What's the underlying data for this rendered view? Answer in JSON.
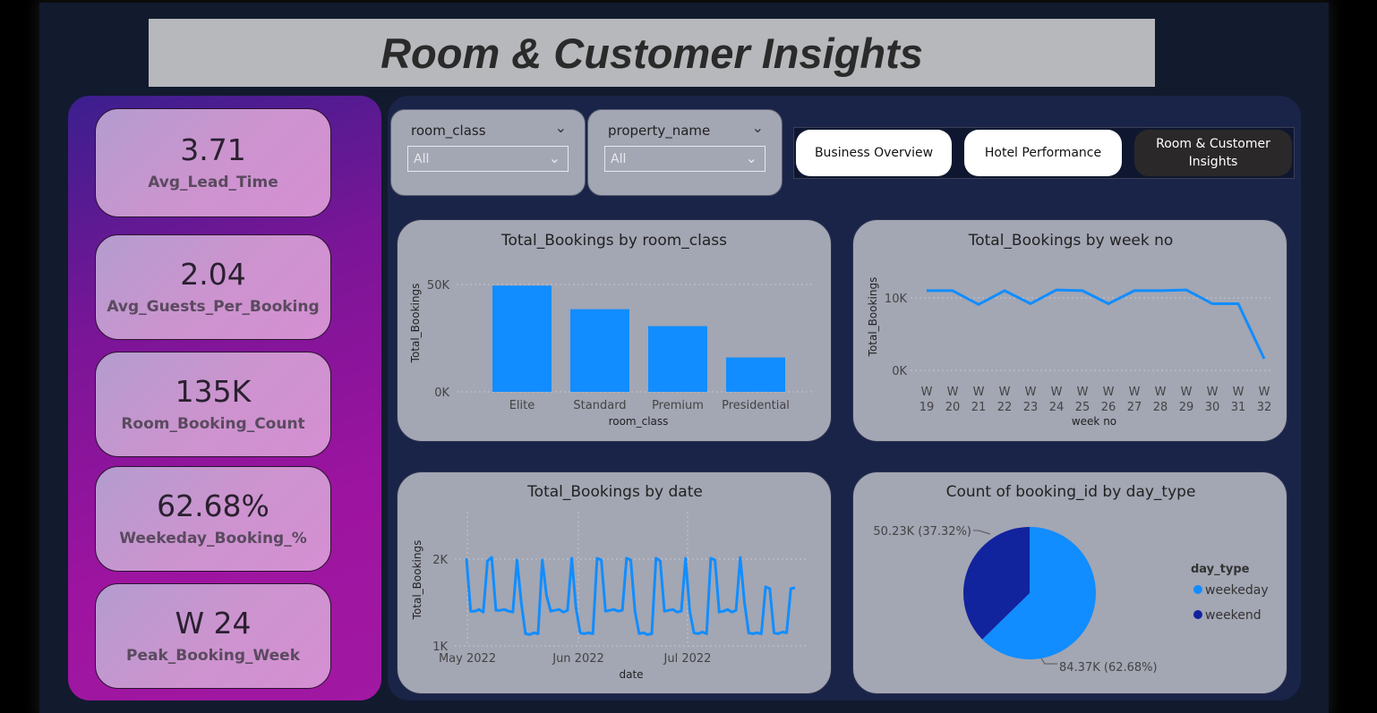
{
  "header": {
    "title": "Room & Customer Insights"
  },
  "kpis": [
    {
      "value": "3.71",
      "label": "Avg_Lead_Time"
    },
    {
      "value": "2.04",
      "label": "Avg_Guests_Per_Booking"
    },
    {
      "value": "135K",
      "label": "Room_Booking_Count"
    },
    {
      "value": "62.68%",
      "label": "Weekeday_Booking_%"
    },
    {
      "value": "W 24",
      "label": "Peak_Booking_Week"
    }
  ],
  "slicers": [
    {
      "title": "room_class",
      "value": "All"
    },
    {
      "title": "property_name",
      "value": "All"
    }
  ],
  "nav": [
    {
      "label": "Business Overview",
      "active": false
    },
    {
      "label": "Hotel Performance",
      "active": false
    },
    {
      "label": "Room & Customer Insights",
      "active": true
    }
  ],
  "colors": {
    "accent": "#118dff",
    "dark_series": "#12239e",
    "kpi_panel": "#9d14a0",
    "background": "#121a2e"
  },
  "chart_data": [
    {
      "type": "bar",
      "title": "Total_Bookings by room_class",
      "xlabel": "room_class",
      "ylabel": "Total_Bookings",
      "categories": [
        "Elite",
        "Standard",
        "Premium",
        "Presidential"
      ],
      "values": [
        49500,
        38500,
        30600,
        16000
      ],
      "ylim": [
        0,
        50000
      ],
      "yticks": [
        "0K",
        "50K"
      ],
      "grid": true
    },
    {
      "type": "line",
      "title": "Total_Bookings by week no",
      "xlabel": "week no",
      "ylabel": "Total_Bookings",
      "categories": [
        "W 19",
        "W 20",
        "W 21",
        "W 22",
        "W 23",
        "W 24",
        "W 25",
        "W 26",
        "W 27",
        "W 28",
        "W 29",
        "W 30",
        "W 31",
        "W 32"
      ],
      "values": [
        11000,
        11000,
        9100,
        11000,
        9200,
        11100,
        11000,
        9200,
        11000,
        11000,
        11100,
        9200,
        9200,
        1600
      ],
      "ylim": [
        0,
        10000
      ],
      "yticks": [
        "0K",
        "10K"
      ],
      "grid": true
    },
    {
      "type": "line",
      "title": "Total_Bookings by date",
      "xlabel": "date",
      "ylabel": "Total_Bookings",
      "x_ticks": [
        "May 2022",
        "Jun 2022",
        "Jul 2022"
      ],
      "yticks": [
        "1K",
        "2K"
      ],
      "ylim": [
        1000,
        2000
      ],
      "values": [
        2010,
        1400,
        1400,
        1420,
        1390,
        1980,
        2020,
        1410,
        1410,
        1420,
        1400,
        1390,
        1990,
        1500,
        1140,
        1130,
        1150,
        1140,
        1990,
        1580,
        1400,
        1410,
        1420,
        1390,
        1410,
        2010,
        1440,
        1150,
        1140,
        1150,
        1140,
        2010,
        1990,
        1400,
        1410,
        1420,
        1400,
        1410,
        2010,
        1990,
        1400,
        1140,
        1150,
        1130,
        1140,
        2010,
        1980,
        1400,
        1410,
        1420,
        1390,
        1400,
        2010,
        1400,
        1150,
        1140,
        1160,
        1140,
        2010,
        1990,
        1390,
        1400,
        1420,
        1390,
        1410,
        2020,
        1500,
        1150,
        1140,
        1150,
        1140,
        1680,
        1660,
        1150,
        1140,
        1160,
        1150,
        1660,
        1670
      ],
      "grid": true
    },
    {
      "type": "pie",
      "title": "Count of booking_id by day_type",
      "legend_title": "day_type",
      "legend_position": "right",
      "slices": [
        {
          "name": "weekeday",
          "value": 84370,
          "label": "84.37K (62.68%)"
        },
        {
          "name": "weekend",
          "value": 50230,
          "label": "50.23K (37.32%)"
        }
      ]
    }
  ]
}
